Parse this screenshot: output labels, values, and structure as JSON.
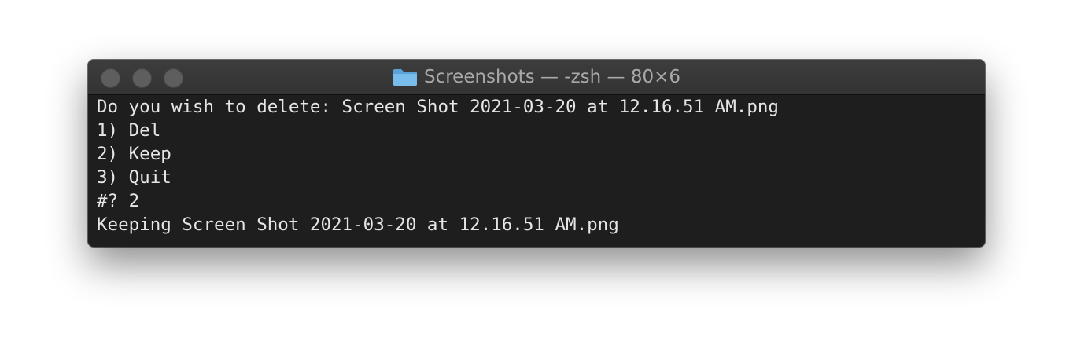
{
  "window": {
    "title": "Screenshots — -zsh — 80×6",
    "folder_icon": "folder-icon",
    "traffic_lights": [
      "close-button",
      "minimize-button",
      "zoom-button"
    ]
  },
  "colors": {
    "terminal_bg": "#1e1e1e",
    "titlebar_bg": "#383838",
    "text": "#e6e6e6",
    "title_text": "#a9a9a9",
    "folder": "#6fb3e4"
  },
  "terminal": {
    "lines": [
      "Do you wish to delete: Screen Shot 2021-03-20 at 12.16.51 AM.png",
      "1) Del",
      "2) Keep",
      "3) Quit",
      "#? 2",
      "Keeping Screen Shot 2021-03-20 at 12.16.51 AM.png"
    ]
  }
}
